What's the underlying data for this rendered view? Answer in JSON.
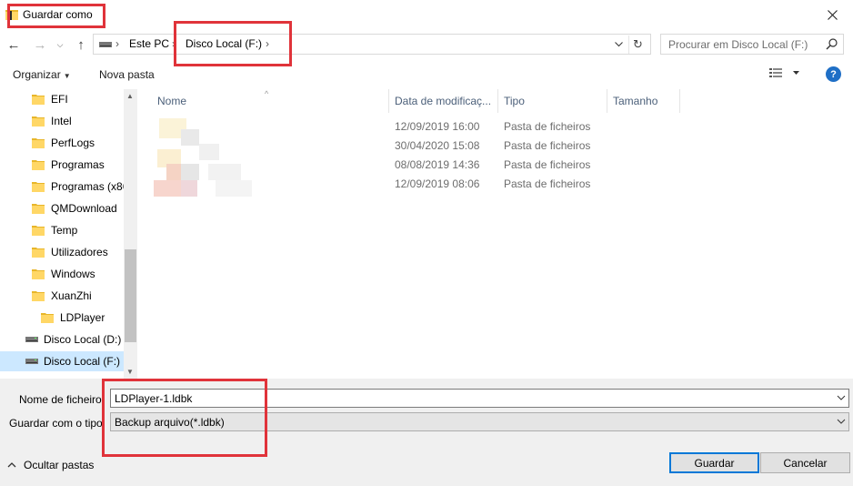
{
  "window": {
    "title": "Guardar como"
  },
  "address": {
    "crumbs": [
      "Este PC",
      "Disco Local (F:)"
    ]
  },
  "search": {
    "placeholder": "Procurar em Disco Local (F:)"
  },
  "toolbar": {
    "organize_label": "Organizar",
    "new_folder_label": "Nova pasta",
    "help_label": "?"
  },
  "nav_tree": [
    {
      "label": "EFI",
      "type": "folder"
    },
    {
      "label": "Intel",
      "type": "folder"
    },
    {
      "label": "PerfLogs",
      "type": "folder"
    },
    {
      "label": "Programas",
      "type": "folder"
    },
    {
      "label": "Programas (x86)",
      "type": "folder"
    },
    {
      "label": "QMDownload",
      "type": "folder"
    },
    {
      "label": "Temp",
      "type": "folder"
    },
    {
      "label": "Utilizadores",
      "type": "folder"
    },
    {
      "label": "Windows",
      "type": "folder"
    },
    {
      "label": "XuanZhi",
      "type": "folder"
    },
    {
      "label": "LDPlayer",
      "type": "folder"
    },
    {
      "label": "Disco Local (D:)",
      "type": "drive"
    },
    {
      "label": "Disco Local (F:)",
      "type": "drive",
      "selected": true
    }
  ],
  "columns": {
    "name": "Nome",
    "date": "Data de modificaç...",
    "type": "Tipo",
    "size": "Tamanho"
  },
  "files": [
    {
      "date": "12/09/2019 16:00",
      "type": "Pasta de ficheiros"
    },
    {
      "date": "30/04/2020 15:08",
      "type": "Pasta de ficheiros"
    },
    {
      "date": "08/08/2019 14:36",
      "type": "Pasta de ficheiros"
    },
    {
      "date": "12/09/2019 08:06",
      "type": "Pasta de ficheiros"
    }
  ],
  "form": {
    "filename_label": "Nome de ficheiro:",
    "filename_value": "LDPlayer-1.ldbk",
    "filetype_label": "Guardar com o tipo:",
    "filetype_value": "Backup arquivo(*.ldbk)"
  },
  "footer": {
    "hide_folders_label": "Ocultar pastas",
    "save_label": "Guardar",
    "cancel_label": "Cancelar"
  },
  "colors": {
    "accent": "#0078d7",
    "selection": "#cce8ff",
    "annotation": "#e0333a",
    "folder": "#ffd766",
    "help": "#1f6fc6"
  }
}
